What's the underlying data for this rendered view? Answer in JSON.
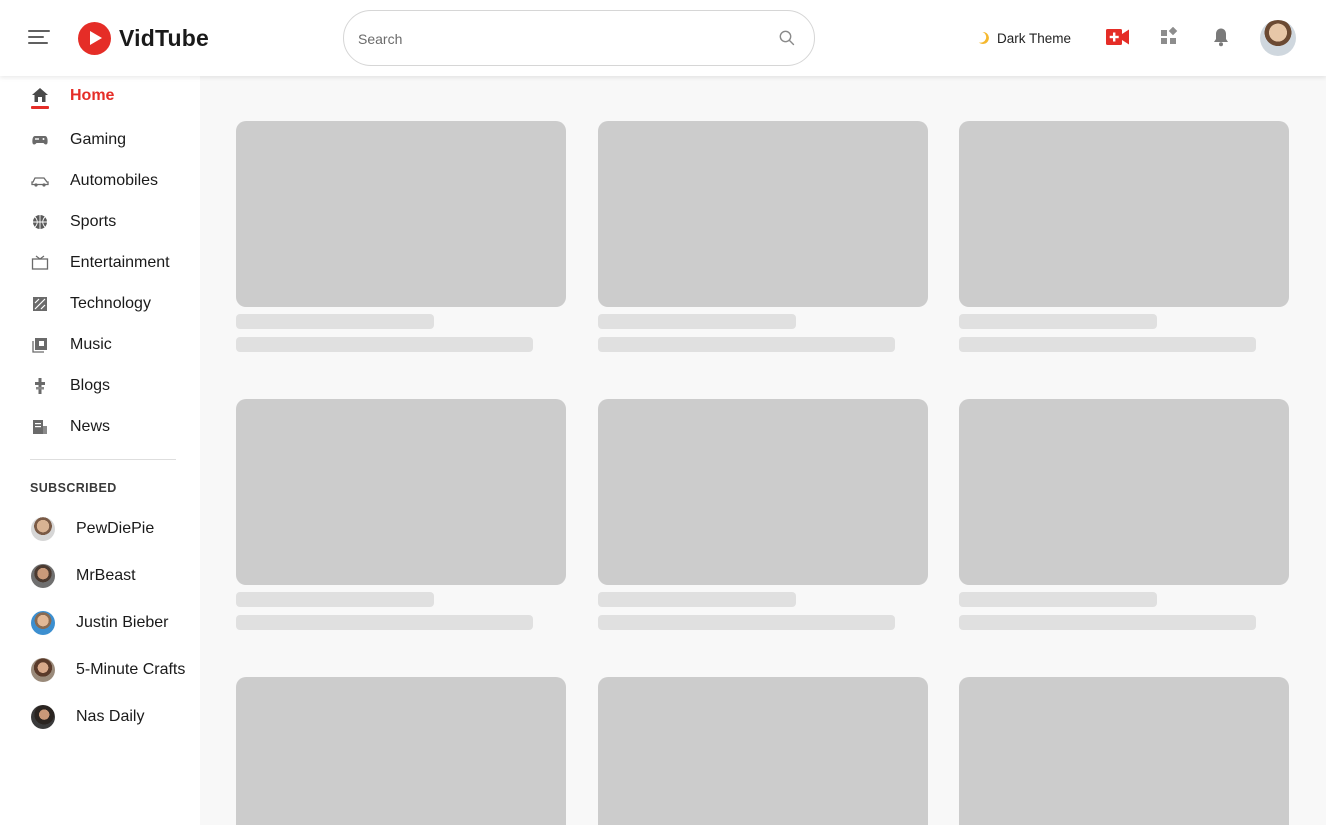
{
  "app": {
    "name": "VidTube",
    "brand_color": "#e52d27"
  },
  "header": {
    "search_placeholder": "Search",
    "dark_theme_label": "Dark Theme",
    "icons": [
      "menu-icon",
      "search-icon",
      "moon-icon",
      "video-camera-icon",
      "apps-grid-icon",
      "bell-icon"
    ]
  },
  "sidebar": {
    "items": [
      {
        "label": "Home",
        "icon": "home-icon",
        "active": true
      },
      {
        "label": "Gaming",
        "icon": "gamepad-icon"
      },
      {
        "label": "Automobiles",
        "icon": "car-icon"
      },
      {
        "label": "Sports",
        "icon": "basketball-icon"
      },
      {
        "label": "Entertainment",
        "icon": "tv-icon"
      },
      {
        "label": "Technology",
        "icon": "technology-icon"
      },
      {
        "label": "Music",
        "icon": "music-icon"
      },
      {
        "label": "Blogs",
        "icon": "blog-icon"
      },
      {
        "label": "News",
        "icon": "newspaper-icon"
      }
    ],
    "subscribed_title": "SUBSCRIBED",
    "subscriptions": [
      {
        "label": "PewDiePie"
      },
      {
        "label": "MrBeast"
      },
      {
        "label": "Justin Bieber"
      },
      {
        "label": "5-Minute Crafts"
      },
      {
        "label": "Nas Daily"
      }
    ]
  },
  "feed": {
    "state": "loading-skeleton",
    "rows_visible": 3,
    "columns": 3
  }
}
